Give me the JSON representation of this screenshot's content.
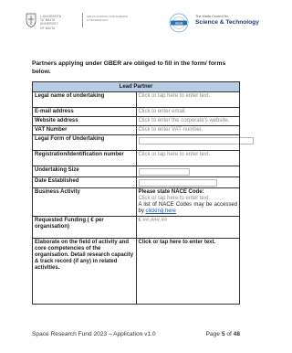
{
  "header": {
    "university_lines": [
      "L-UNIVERSITÀ",
      "TA' MALTA",
      "UNIVERSITY",
      "OF MALTA"
    ],
    "council_lines": [
      "MALTA COUNCIL FOR SCIENCE",
      "& TECHNOLOGY"
    ],
    "mcst_small": "The Malta Council for",
    "mcst_big": "Science & Technology"
  },
  "intro": "Partners applying under GBER are obliged to fill in the form/ forms below.",
  "table": {
    "title": "Lead Partner",
    "rows": {
      "legal_name": {
        "label": "Legal name of undertaking",
        "value": "Click or tap here to enter text."
      },
      "email": {
        "label": "E-mail address",
        "value": "Click to enter email."
      },
      "website": {
        "label": "Website address",
        "value": "Click to enter the corporate's website."
      },
      "vat": {
        "label": "VAT Number",
        "value": "Click to enter VAT number."
      },
      "legal_form": {
        "label": "Legal Form of Undertaking"
      },
      "registration": {
        "label": "Registration/Identification number",
        "value": "Click or tap here to enter text."
      },
      "undertaking_size": {
        "label": "Undertaking Size"
      },
      "date_established": {
        "label": "Date Established"
      },
      "business_activity": {
        "label": "Business Activity",
        "nace_title": "Please state NACE Code:",
        "value": "Click or tap here to enter text.",
        "list_text": "A list of NACE Codes may be accessed by",
        "link_text": "clicking here"
      },
      "requested_funding": {
        "label": "Requested Funding ( € per organisation)",
        "value": "€ ##,###.##"
      },
      "elaborate": {
        "label": "Elaborate on the field of activity and core competencies of the organisation. Detail research capacity & track record (if any) in related activities.",
        "value": "Click or tap here to enter text."
      }
    }
  },
  "footer": {
    "left": "Space Research Fund 2023 – Application v1.0",
    "page_prefix": "Page ",
    "page_current": "5",
    "page_mid": " of ",
    "page_total": "48"
  }
}
